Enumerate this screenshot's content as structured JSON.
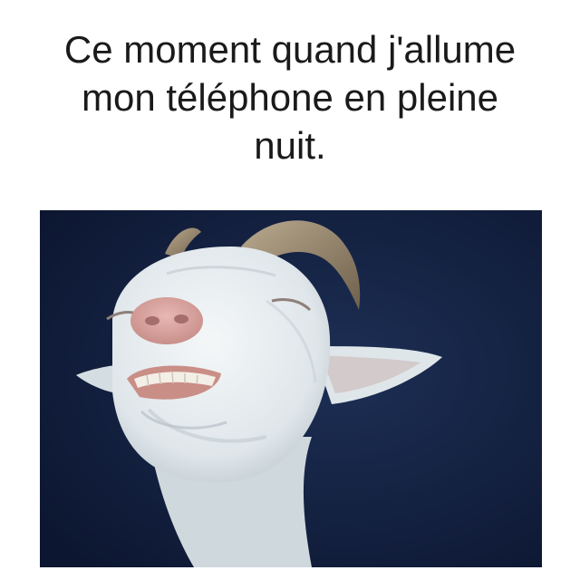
{
  "caption": {
    "line1": "Ce moment quand j'allume",
    "line2": "mon téléphone en pleine",
    "line3": "nuit."
  },
  "photo": {
    "subject": "goat-face",
    "background_color": "#13213f",
    "fur_color": "#e6ecef",
    "horn_color": "#9a8a72",
    "nose_color": "#d7a3a0"
  }
}
